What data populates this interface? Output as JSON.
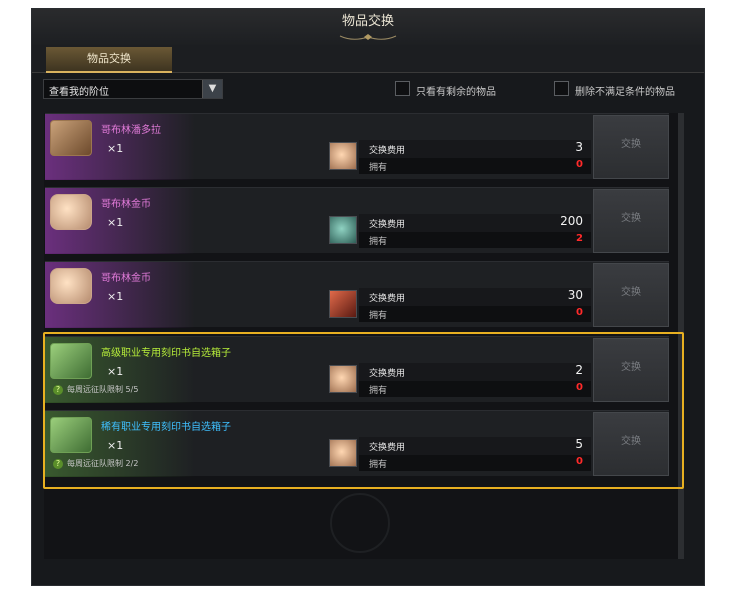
{
  "window": {
    "title": "物品交换"
  },
  "tabs": [
    {
      "label": "物品交换"
    }
  ],
  "filters": {
    "select_value": "查看我的阶位",
    "check_remaining": "只看有剩余的物品",
    "check_hide_unmet": "删除不满足条件的物品"
  },
  "rows": [
    {
      "name": "哥布林潘多拉",
      "name_color": "purple",
      "qty": "×1",
      "item_icon": "brown-chest-icon",
      "cost_icon": "coin-icon",
      "limit": "",
      "cost_label": "交换费用",
      "own_label": "拥有",
      "cost": "3",
      "own": "0",
      "button": "交换"
    },
    {
      "name": "哥布林金币",
      "name_color": "purple",
      "qty": "×1",
      "item_icon": "goblin-coin-icon",
      "cost_icon": "teal-token-icon",
      "limit": "",
      "cost_label": "交换费用",
      "own_label": "拥有",
      "cost": "200",
      "own": "2",
      "button": "交换"
    },
    {
      "name": "哥布林金币",
      "name_color": "purple",
      "qty": "×1",
      "item_icon": "goblin-coin-icon",
      "cost_icon": "red-feather-icon",
      "limit": "",
      "cost_label": "交换费用",
      "own_label": "拥有",
      "cost": "30",
      "own": "0",
      "button": "交换"
    },
    {
      "name": "高级职业专用刻印书自选箱子",
      "name_color": "green",
      "qty": "×1",
      "item_icon": "green-chest-icon",
      "cost_icon": "coin-icon",
      "limit": "每周远征队限制 5/5",
      "cost_label": "交换费用",
      "own_label": "拥有",
      "cost": "2",
      "own": "0",
      "button": "交换"
    },
    {
      "name": "稀有职业专用刻印书自选箱子",
      "name_color": "blue",
      "qty": "×1",
      "item_icon": "green-chest-icon",
      "cost_icon": "coin-icon",
      "limit": "每周远征队限制 2/2",
      "cost_label": "交换费用",
      "own_label": "拥有",
      "cost": "5",
      "own": "0",
      "button": "交换"
    }
  ],
  "colors": {
    "highlight": "#e8b021",
    "own_insufficient": "#ff2a2a"
  }
}
